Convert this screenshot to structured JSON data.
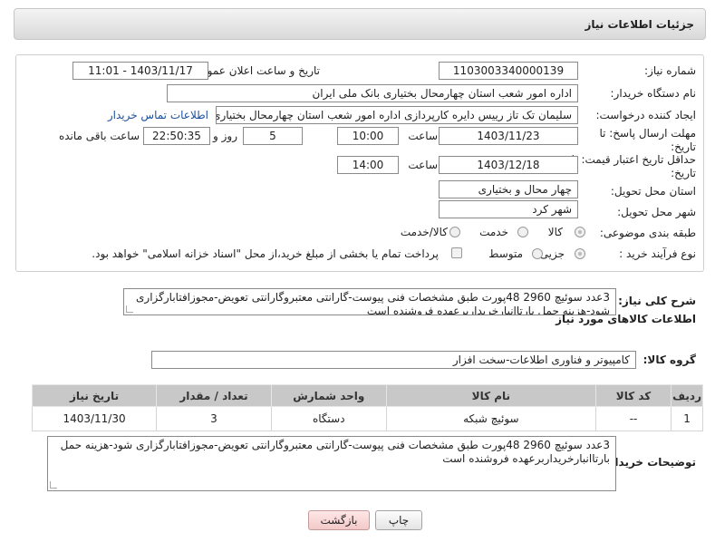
{
  "header": {
    "title": "جزئیات اطلاعات نیاز"
  },
  "form": {
    "need_number": {
      "label": "شماره نیاز:",
      "value": "1103003340000139"
    },
    "announce_datetime": {
      "label": "تاریخ و ساعت اعلان عمومی:",
      "value": "1403/11/17 - 11:01"
    },
    "buyer_org": {
      "label": "نام دستگاه خریدار:",
      "value": "اداره امور شعب استان چهارمحال بختیاری بانک ملی ایران"
    },
    "requester": {
      "label": "ایجاد کننده درخواست:",
      "value": "سلیمان تک تاز رییس دایره کارپردازی  اداره امور شعب استان چهارمحال بختیاری",
      "link": "اطلاعات تماس خریدار"
    },
    "reply_deadline": {
      "label_line1": "مهلت ارسال پاسخ: تا",
      "label_line2": "تاریخ:",
      "date": "1403/11/23",
      "time_label": "ساعت",
      "time": "10:00",
      "days": "5",
      "days_label": "روز و",
      "remaining": "22:50:35",
      "remaining_label": "ساعت باقی مانده"
    },
    "price_validity": {
      "label_line1": "حداقل تاریخ اعتبار قیمت: تا",
      "label_line2": "تاریخ:",
      "date": "1403/12/18",
      "time_label": "ساعت",
      "time": "14:00"
    },
    "delivery_province": {
      "label": "استان محل تحویل:",
      "value": "چهار محال و بختیاری"
    },
    "delivery_city": {
      "label": "شهر محل تحویل:",
      "value": "شهر کرد"
    },
    "category": {
      "label": "طبقه بندی موضوعی:",
      "options": [
        "کالا",
        "خدمت",
        "کالا/خدمت"
      ]
    },
    "purchase_type": {
      "label": "نوع فرآیند خرید :",
      "options": [
        "جزیی",
        "متوسط"
      ],
      "payment_note": "پرداخت تمام یا بخشی از مبلغ خرید،از محل \"اسناد خزانه اسلامی\" خواهد بود."
    }
  },
  "summary": {
    "label": "شرح کلی نیاز:",
    "value": "3عدد سوئیچ 2960 48پورت طبق مشخصات فنی پیوست-گارانتی معتبروگارانتی تعویض-مجوزافتابارگزاری شود-هزینه حمل بارتاانبارخریداربرعهده فروشنده است"
  },
  "goods_section": {
    "title": "اطلاعات کالاهای مورد نیاز"
  },
  "goods_group": {
    "label": "گروه کالا:",
    "value": "کامپیوتر و فناوری اطلاعات-سخت افزار"
  },
  "table": {
    "headers": [
      "ردیف",
      "کد کالا",
      "نام کالا",
      "واحد شمارش",
      "تعداد / مقدار",
      "تاریخ نیاز"
    ],
    "rows": [
      [
        "1",
        "--",
        "سوئیچ شبکه",
        "دستگاه",
        "3",
        "1403/11/30"
      ]
    ]
  },
  "buyer_notes": {
    "label": "توضیحات خریدار:",
    "value": "3عدد سوئیچ 2960 48پورت طبق مشخصات فنی پیوست-گارانتی معتبروگارانتی تعویض-مجوزافتابارگزاری شود-هزینه حمل بارتاانبارخریداربرعهده فروشنده است"
  },
  "buttons": {
    "print": "چاپ",
    "back": "بازگشت"
  }
}
